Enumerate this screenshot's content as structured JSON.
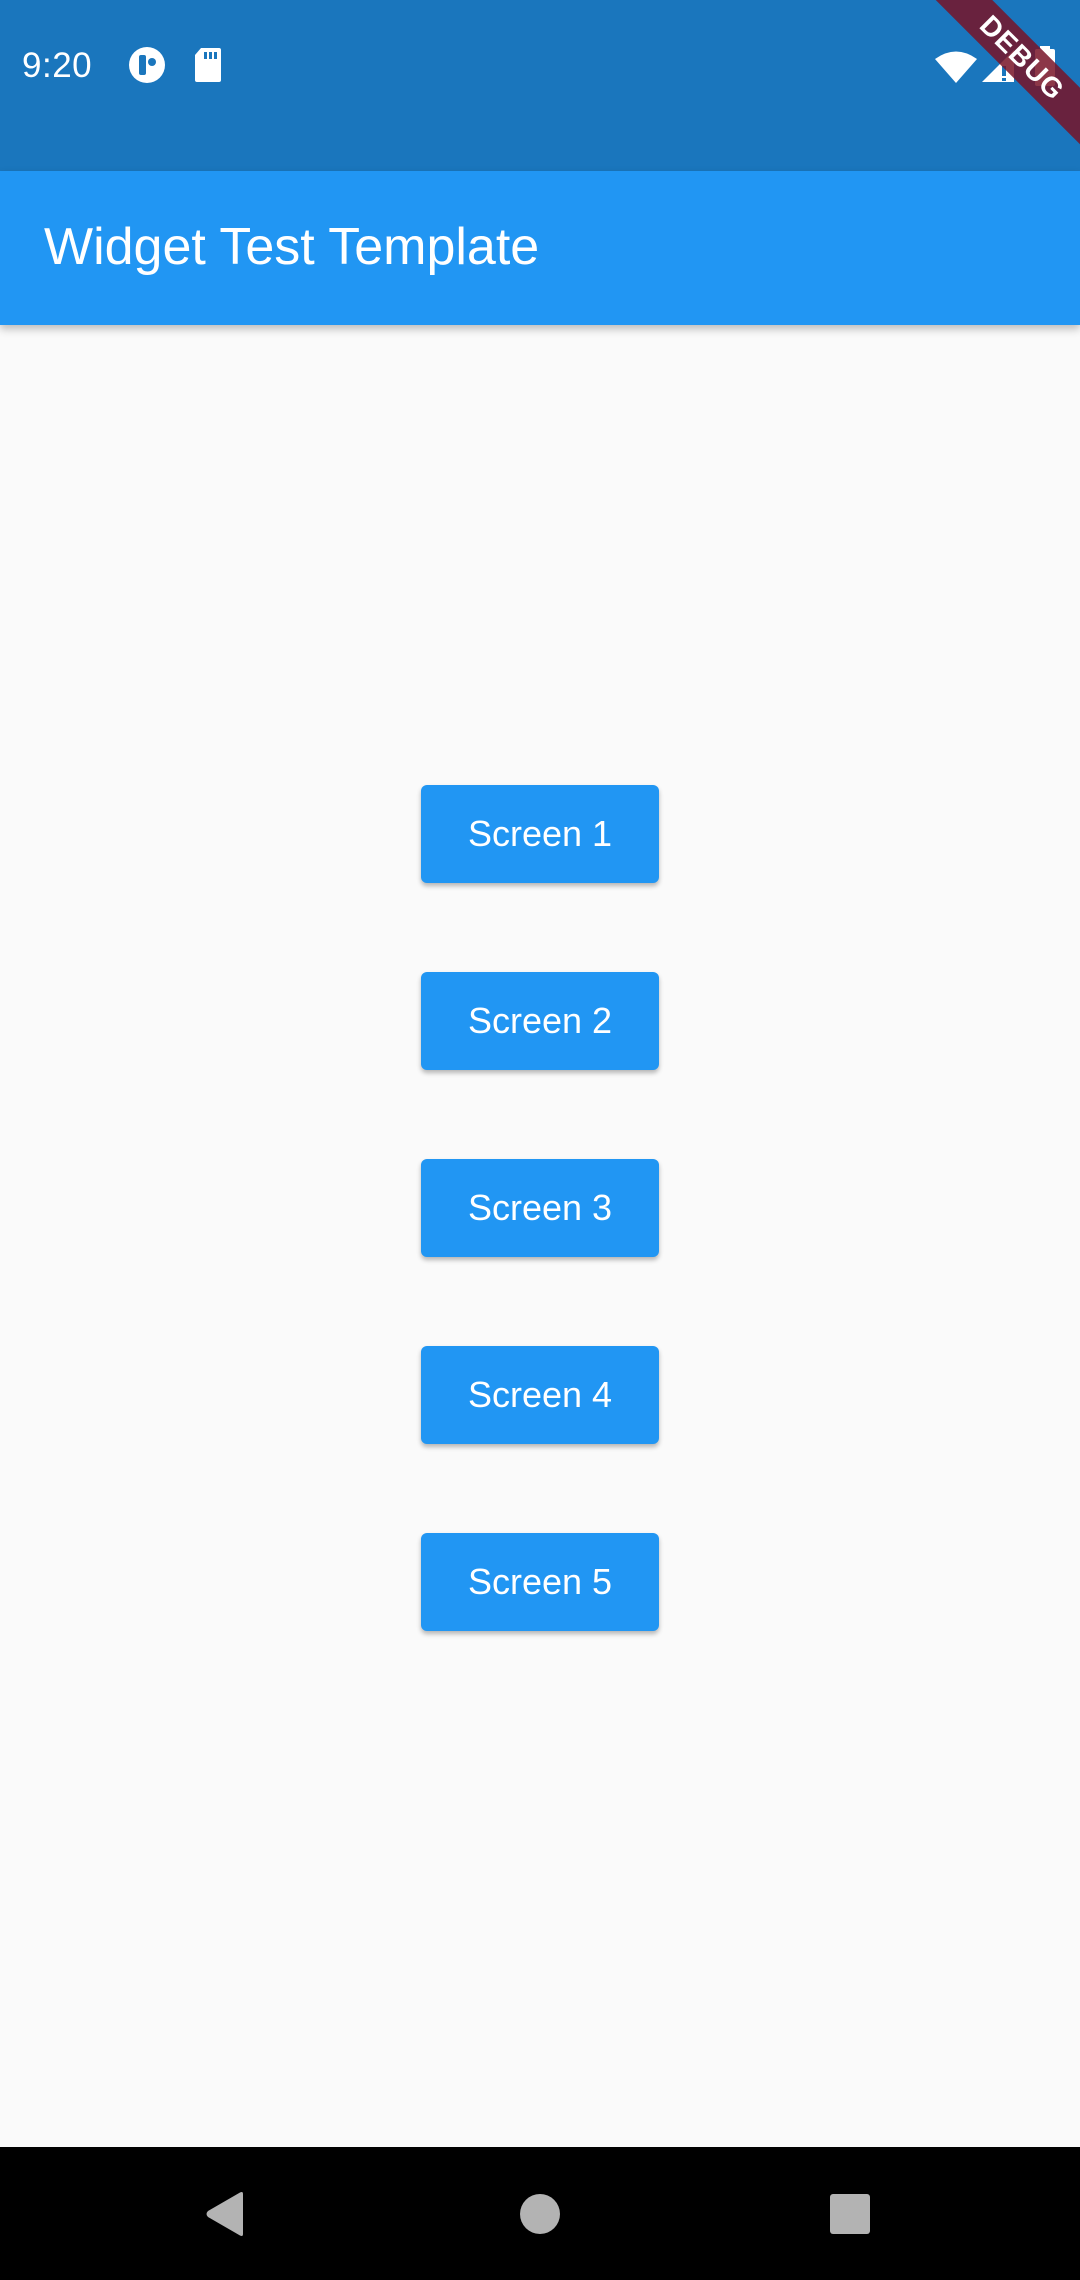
{
  "status_bar": {
    "time": "9:20",
    "icons": [
      "app-notification-icon",
      "sd-card-icon",
      "wifi-icon",
      "cellular-signal-icon",
      "battery-icon"
    ]
  },
  "debug_banner": {
    "label": "DEBUG"
  },
  "app_bar": {
    "title": "Widget Test Template"
  },
  "buttons": [
    {
      "label": "Screen 1"
    },
    {
      "label": "Screen 2"
    },
    {
      "label": "Screen 3"
    },
    {
      "label": "Screen 4"
    },
    {
      "label": "Screen 5"
    }
  ],
  "nav_bar": {
    "icons": [
      "back-icon",
      "home-icon",
      "recents-icon"
    ]
  },
  "colors": {
    "status_bar": "#1a76bd",
    "app_bar": "#2196f3",
    "button": "#2196f3",
    "background": "#fafafa",
    "nav_bar": "#000000",
    "debug_banner": "#78142a"
  }
}
